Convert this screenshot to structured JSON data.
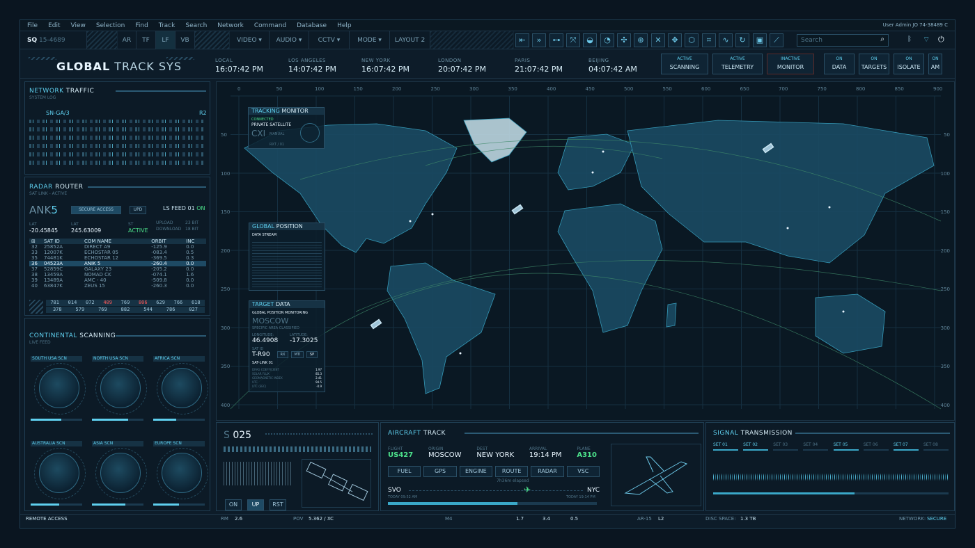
{
  "menu": [
    "File",
    "Edit",
    "View",
    "Selection",
    "Find",
    "Track",
    "Search",
    "Network",
    "Command",
    "Database",
    "Help"
  ],
  "user_info": "User Admin JO 74-38489 C",
  "toolbar": {
    "id_prefix": "SQ",
    "id_value": "15-4689",
    "modes": [
      "AR",
      "TF",
      "LF",
      "VB"
    ],
    "active_mode": "LF",
    "dropdowns": [
      "VIDEO",
      "AUDIO",
      "CCTV",
      "MODE"
    ],
    "layout": "LAYOUT 2",
    "search_placeholder": "Search"
  },
  "header": {
    "title_bold": "GLOBAL",
    "title_rest": " TRACK SYS",
    "cities": [
      {
        "name": "LOCAL",
        "time": "16:07:42 PM"
      },
      {
        "name": "LOS ANGELES",
        "time": "14:07:42 PM"
      },
      {
        "name": "NEW YORK",
        "time": "16:07:42 PM"
      },
      {
        "name": "LONDON",
        "time": "20:07:42 PM"
      },
      {
        "name": "PARIS",
        "time": "21:07:42 PM"
      },
      {
        "name": "BEIJING",
        "time": "04:07:42 AM"
      }
    ],
    "statuses": [
      {
        "state": "ACTIVE",
        "label": "SCANNING"
      },
      {
        "state": "ACTIVE",
        "label": "TELEMETRY"
      },
      {
        "state": "INACTIVE",
        "label": "MONITOR"
      },
      {
        "state": "ON",
        "label": "DATA"
      },
      {
        "state": "ON",
        "label": "TARGETS"
      },
      {
        "state": "ON",
        "label": "ISOLATE"
      },
      {
        "state": "ON",
        "label": "AM"
      }
    ]
  },
  "network": {
    "title_a": "NETWORK",
    "title_b": " TRAFFIC",
    "sub": "SYSTEM LOG",
    "channel": "SN-GA/3",
    "channel_r": "R2"
  },
  "radar": {
    "title_a": "RADAR",
    "title_b": " ROUTER",
    "sub": "SAT LINK - ACTIVE",
    "ank": "ANK",
    "ank_num": "5",
    "secure": "SECURE ACCESS",
    "upd": "UPD",
    "ls_feed": "LS FEED",
    "ls_num": "01",
    "ls_state": "ON",
    "lat_label": "LAT",
    "lat": "-20.45845",
    "lon_label": "LAT",
    "lon": "245.63009",
    "st_label": "ST",
    "st": "ACTIVE",
    "upload": "UPLOAD",
    "upload_v": "23 BIT",
    "download": "DOWNLOAD",
    "download_v": "18 BIT",
    "headers": [
      "SAT ID",
      "COM NAME",
      "ORBIT",
      "INC"
    ],
    "rows": [
      [
        "32",
        "25852A",
        "DIRECT A9",
        "-125.9",
        "0.0"
      ],
      [
        "33",
        "12007K",
        "ECHOSTAR 05",
        "-083.4",
        "0.5"
      ],
      [
        "35",
        "74481K",
        "ECHOSTAR 12",
        "-369.5",
        "0.3"
      ],
      [
        "36",
        "04523A",
        "ANIK 5",
        "-260.4",
        "0.0"
      ],
      [
        "37",
        "52859C",
        "GALAXY 23",
        "-205.2",
        "0.0"
      ],
      [
        "38",
        "13459A",
        "NOMAD CK",
        "-074.1",
        "1.6"
      ],
      [
        "39",
        "13489A",
        "AMC - 40",
        "-509.8",
        "0.0"
      ],
      [
        "40",
        "63847K",
        "ZEUS 15",
        "-260.3",
        "0.0"
      ]
    ],
    "nums1": [
      "781",
      "014",
      "072",
      "409",
      "769",
      "806",
      "629",
      "766",
      "618"
    ],
    "nums2": [
      "378",
      "",
      "579",
      "",
      "769",
      "882",
      "",
      "544",
      "786",
      "027"
    ]
  },
  "continental": {
    "title_a": "CONTINENTAL",
    "title_b": " SCANNING",
    "sub": "LIVE FEED",
    "regions": [
      "SOUTH USA SCN",
      "NORTH USA SCN",
      "AFRICA SCN",
      "AUSTRALIA SCN",
      "ASIA SCN",
      "EUROPE SCN"
    ]
  },
  "map": {
    "top_ticks": [
      "0",
      "50",
      "100",
      "150",
      "200",
      "250",
      "300",
      "350",
      "400",
      "450",
      "500",
      "550",
      "600",
      "650",
      "700",
      "750",
      "800",
      "850",
      "900"
    ],
    "side_ticks": [
      "50",
      "100",
      "150",
      "200",
      "250",
      "300",
      "350",
      "400"
    ]
  },
  "tracking": {
    "title_a": "TRACKING",
    "title_b": " MONITOR",
    "connected": "CONNECTED",
    "private": "PRIVATE SATELLITE",
    "cxi": "CXI",
    "manual": "MANUAL",
    "rxt": "RXT / 01"
  },
  "global_pos": {
    "title_a": "GLOBAL",
    "title_b": " POSITION",
    "stream": "DATA STREAM"
  },
  "target": {
    "title_a": "TARGET",
    "title_b": " DATA",
    "mon": "GLOBAL POSITION MONITORING",
    "city": "MOSCOW",
    "spec": "SPECIFIC AREA CLASSIFIED",
    "lon_label": "LONGITUDE:",
    "lon": "46.4908",
    "lat_label": "LATITUDE:",
    "lat": "-17.3025",
    "sat_label": "SAT ID",
    "sat": "T-R90",
    "btns": [
      "RX",
      "MTI",
      "SP"
    ],
    "link": "SAT-LINK 01",
    "params": [
      [
        "DRAG COEFFICIENT",
        "1.97"
      ],
      [
        "SOLAR FLUX",
        "85.3"
      ],
      [
        "GEOMAGNETIC INDEX",
        "2.41"
      ],
      [
        "UTC",
        "94.5"
      ],
      [
        "UTC (SEC)",
        "-0.9"
      ]
    ]
  },
  "s025": {
    "s": "S",
    "num": "025",
    "btns": [
      "ON",
      "UP",
      "RST"
    ]
  },
  "aircraft": {
    "title_a": "AIRCRAFT",
    "title_b": " TRACK",
    "fields": [
      {
        "label": "FLIGHT",
        "value": "US427"
      },
      {
        "label": "ORIGIN",
        "value": "MOSCOW"
      },
      {
        "label": "DEST",
        "value": "NEW YORK"
      },
      {
        "label": "ARRIVAL",
        "value": "19:14 PM"
      },
      {
        "label": "PLANE",
        "value": "A310"
      }
    ],
    "systems": [
      "FUEL",
      "GPS",
      "ENGINE",
      "ROUTE",
      "RADAR",
      "VSC"
    ],
    "elapsed": "7h36m elapsed",
    "from": "SVO",
    "to": "NYC",
    "from_time": "TODAY 09:52 AM",
    "to_time": "TODAY 19:14 PM",
    "progress": 0.62
  },
  "signal": {
    "title_a": "SIGNAL",
    "title_b": " TRANSMISSION",
    "sets": [
      "SET 01",
      "SET 02",
      "SET 03",
      "SET 04",
      "SET 05",
      "SET 06",
      "SET 07",
      "SET 08"
    ]
  },
  "statusbar": {
    "remote": "REMOTE ACCESS",
    "rm_label": "RM",
    "rm": "2.6",
    "pov_label": "POV",
    "pov": "5.362 / XC",
    "m4": "M4",
    "v1": "1.7",
    "v2": "3.4",
    "v3": "0.5",
    "ar": "AR-15",
    "l2": "L2",
    "disc_label": "DISC SPACE:",
    "disc": "1.3 TB",
    "net_label": "NETWORK:",
    "net": "SECURE"
  },
  "colors": {
    "accent": "#5fd0ef",
    "bg": "#0d1c29",
    "green": "#4ce08a",
    "red": "#ff5a5a"
  }
}
